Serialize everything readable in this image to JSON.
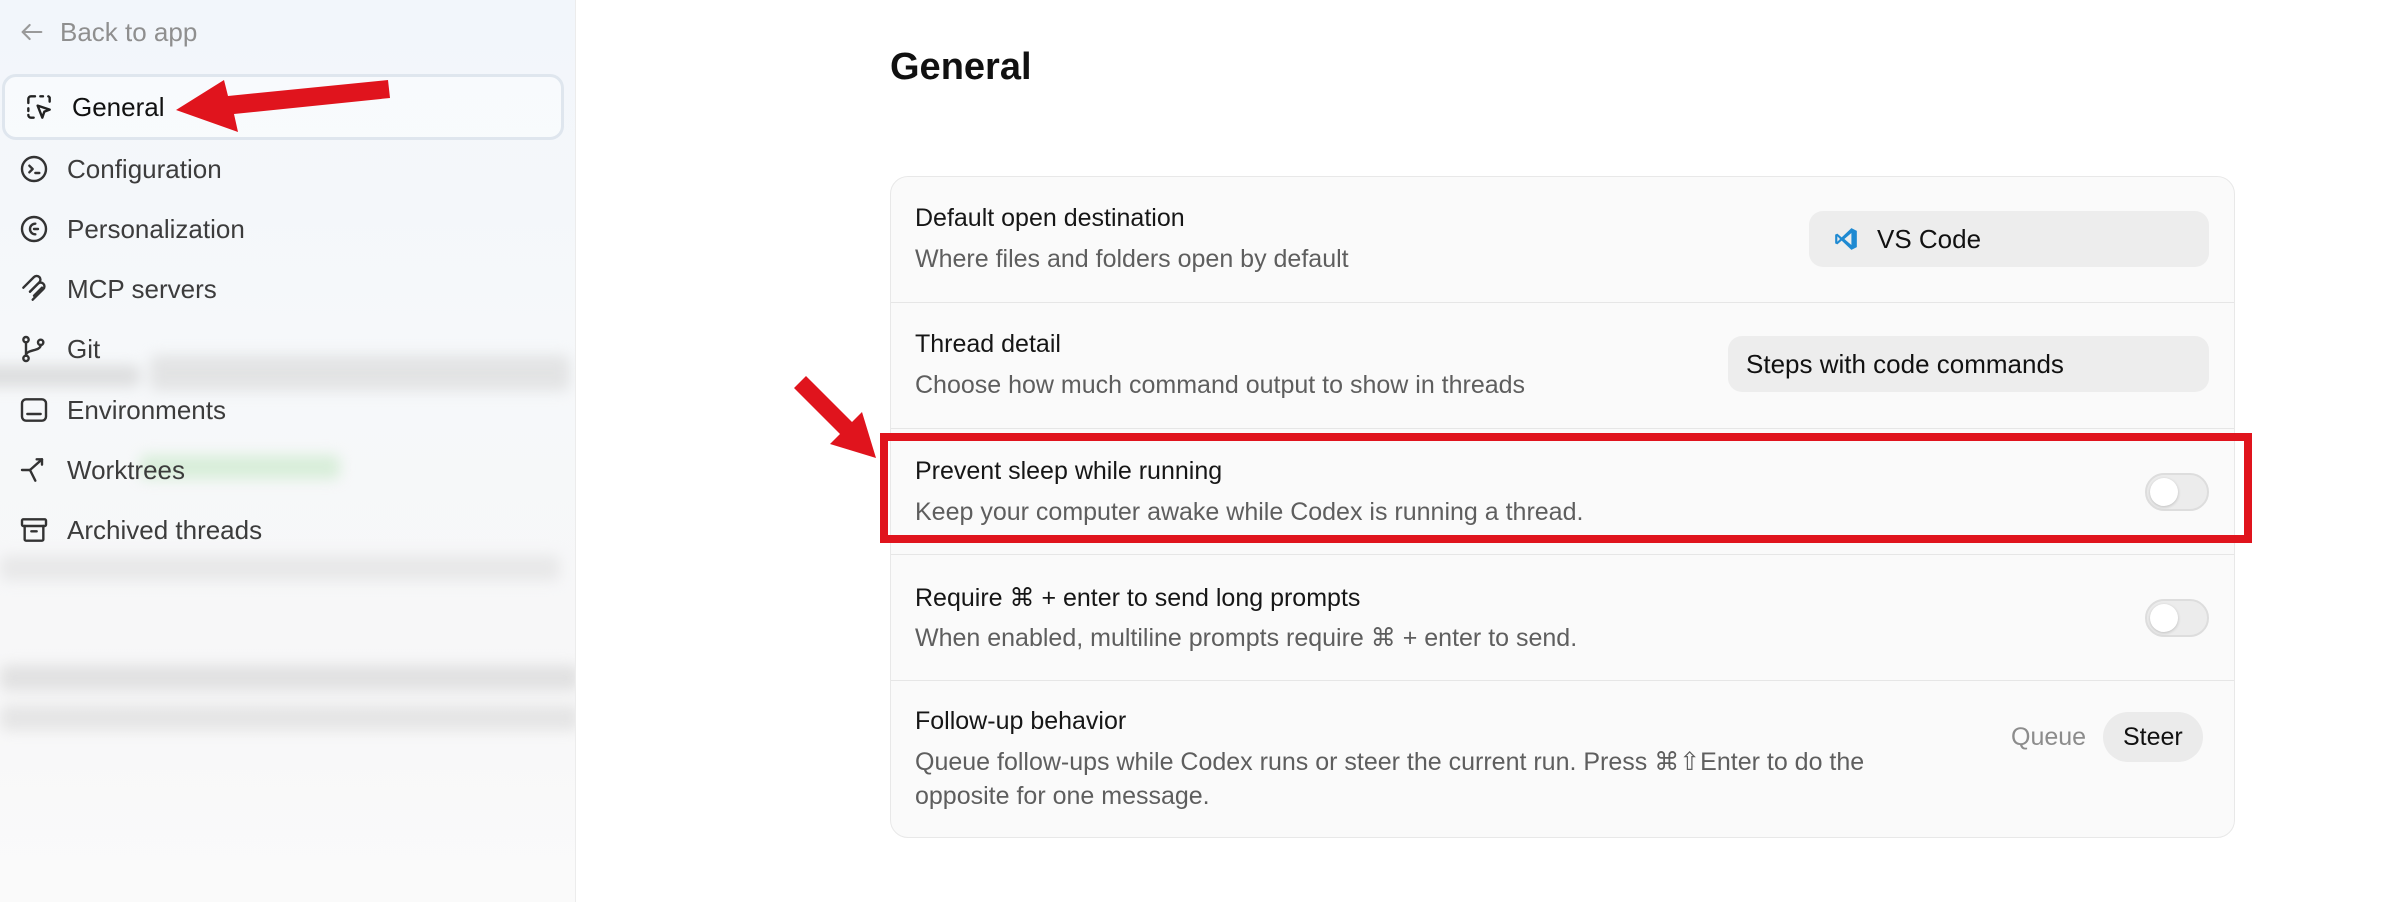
{
  "sidebar": {
    "back_label": "Back to app",
    "items": [
      {
        "label": "General",
        "icon": "cursor-select-icon",
        "active": true
      },
      {
        "label": "Configuration",
        "icon": "terminal-circle-icon"
      },
      {
        "label": "Personalization",
        "icon": "personalization-icon"
      },
      {
        "label": "MCP servers",
        "icon": "mcp-icon"
      },
      {
        "label": "Git",
        "icon": "git-branch-icon"
      },
      {
        "label": "Environments",
        "icon": "environment-icon"
      },
      {
        "label": "Worktrees",
        "icon": "worktree-icon"
      },
      {
        "label": "Archived threads",
        "icon": "archive-icon"
      }
    ]
  },
  "main": {
    "title": "General",
    "settings": {
      "open_destination": {
        "title": "Default open destination",
        "description": "Where files and folders open by default",
        "value": "VS Code",
        "icon": "vscode-icon"
      },
      "thread_detail": {
        "title": "Thread detail",
        "description": "Choose how much command output to show in threads",
        "value": "Steps with code commands"
      },
      "prevent_sleep": {
        "title": "Prevent sleep while running",
        "description": "Keep your computer awake while Codex is running a thread.",
        "enabled": false
      },
      "require_cmd_enter": {
        "title": "Require ⌘ + enter to send long prompts",
        "description": "When enabled, multiline prompts require ⌘ + enter to send.",
        "enabled": false
      },
      "follow_up": {
        "title": "Follow-up behavior",
        "description_line1": "Queue follow-ups while Codex runs or steer the current run. Press ⌘⇧Enter to do the",
        "description_line2": "opposite for one message.",
        "options": [
          "Queue",
          "Steer"
        ],
        "selected": "Steer"
      }
    }
  },
  "annotations": {
    "highlight_color": "#e0141d"
  }
}
